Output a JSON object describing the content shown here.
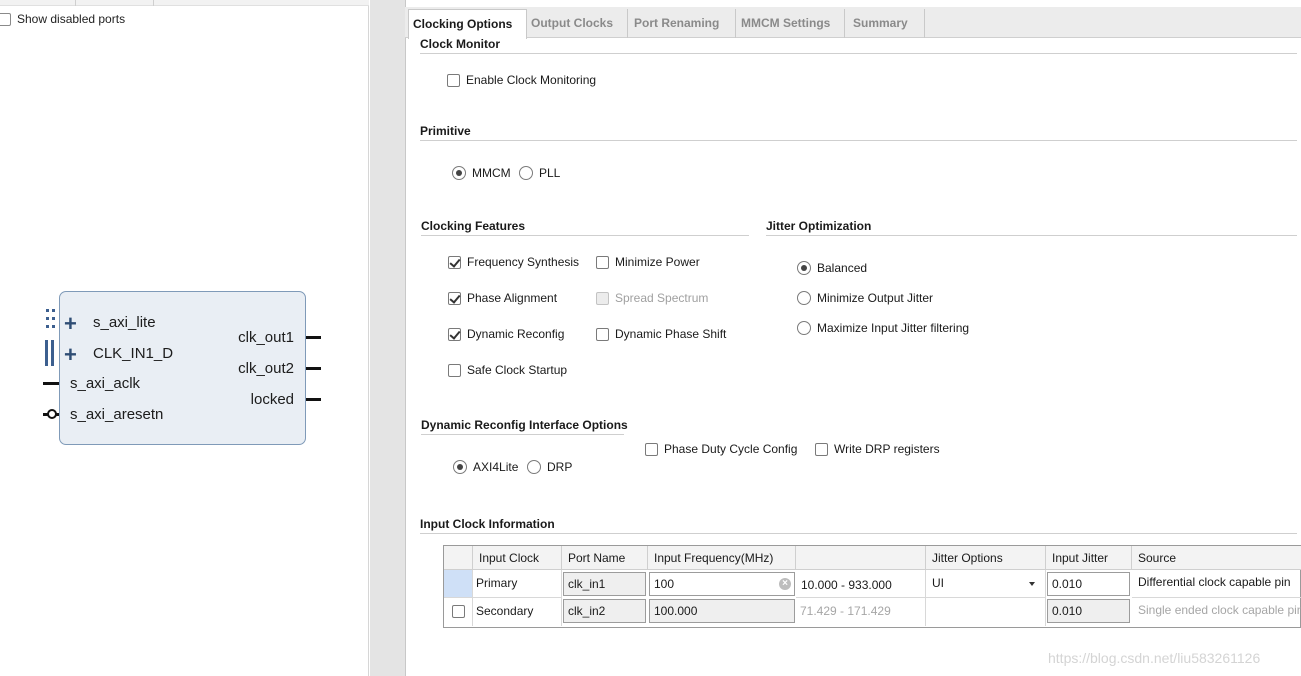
{
  "left_panel": {
    "show_disabled_ports": "Show disabled ports",
    "ports_left": [
      "s_axi_lite",
      "CLK_IN1_D",
      "s_axi_aclk",
      "s_axi_aresetn"
    ],
    "ports_right": [
      "clk_out1",
      "clk_out2",
      "locked"
    ]
  },
  "tabs": [
    "Clocking Options",
    "Output Clocks",
    "Port Renaming",
    "MMCM Settings",
    "Summary"
  ],
  "clock_monitor": {
    "title": "Clock Monitor",
    "enable_label": "Enable Clock Monitoring",
    "enable_checked": false
  },
  "primitive": {
    "title": "Primitive",
    "options": [
      "MMCM",
      "PLL"
    ],
    "selected": "MMCM"
  },
  "clocking_features": {
    "title": "Clocking Features",
    "frequency_synthesis": "Frequency Synthesis",
    "minimize_power": "Minimize Power",
    "phase_alignment": "Phase Alignment",
    "spread_spectrum": "Spread Spectrum",
    "dynamic_reconfig": "Dynamic Reconfig",
    "dynamic_phase_shift": "Dynamic Phase Shift",
    "safe_clock_startup": "Safe Clock Startup"
  },
  "jitter_optimization": {
    "title": "Jitter Optimization",
    "options": [
      "Balanced",
      "Minimize Output Jitter",
      "Maximize Input Jitter filtering"
    ],
    "selected": "Balanced"
  },
  "drp_options": {
    "title": "Dynamic Reconfig Interface Options",
    "phase_duty_cycle": "Phase Duty Cycle Config",
    "write_drp": "Write DRP registers",
    "axi4lite": "AXI4Lite",
    "drp": "DRP",
    "selected": "AXI4Lite"
  },
  "input_clock_info": {
    "title": "Input Clock Information",
    "headers": [
      "Input Clock",
      "Port Name",
      "Input Frequency(MHz)",
      "",
      "Jitter Options",
      "Input Jitter",
      "Source"
    ],
    "rows": [
      {
        "input_clock": "Primary",
        "port_name": "clk_in1",
        "frequency": "100",
        "range": "10.000 - 933.000",
        "jitter_option": "UI",
        "input_jitter": "0.010",
        "source": "Differential clock capable pin"
      },
      {
        "input_clock": "Secondary",
        "port_name": "clk_in2",
        "frequency": "100.000",
        "range": "71.429 - 171.429",
        "jitter_option": "",
        "input_jitter": "0.010",
        "source": "Single ended clock capable pin"
      }
    ]
  },
  "watermark": "https://blog.csdn.net/liu583261126"
}
